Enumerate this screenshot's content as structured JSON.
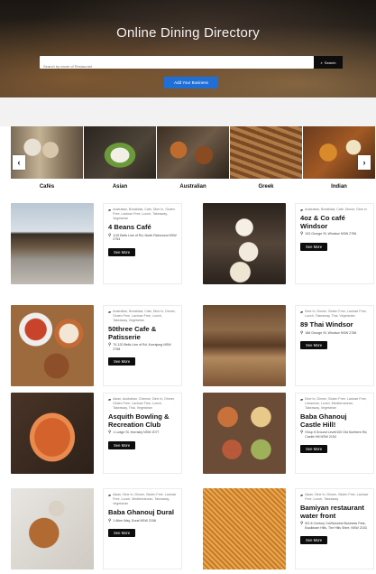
{
  "hero": {
    "title": "Online Dining Directory",
    "search_placeholder": "Search by name of Restaurant",
    "search_button": "Search",
    "add_business_button": "Add Your Business"
  },
  "categories": {
    "prev_arrow": "‹",
    "next_arrow": "›",
    "items": [
      {
        "label": "Cafés"
      },
      {
        "label": "Asian"
      },
      {
        "label": "Australian"
      },
      {
        "label": "Greek"
      },
      {
        "label": "Indian"
      }
    ]
  },
  "listings": [
    {
      "tags": "Australian, Breakfast, Cafe, Dine In, Gluten Free, Lactose Free, Lunch, Takeaway, Vegetarian",
      "name": "4 Beans Café",
      "address": "1/15 Bells Line of Rd, North Richmond NSW 2754",
      "button": "See More"
    },
    {
      "tags": "Australian, Breakfast, Cafe, Dinner, Dine In",
      "name": "4oz & Co café Windsor",
      "address": "103 George St, Windsor NSW 2756",
      "button": "See More"
    },
    {
      "tags": "Australian, Breakfast, Cafe, Dine In, Dinner, Gluten Free, Lactose Free, Lunch, Takeaway, Vegetarian",
      "name": "50three Cafe & Patisserie",
      "address": "70-120 Bells Line of Rd, Kurrajong NSW 2758",
      "button": "See More"
    },
    {
      "tags": "Dine In, Dinner, Gluten Free, Lactose Free, Lunch, Takeaway, Thai, Vegetarian",
      "name": "89 Thai Windsor",
      "address": "186 George St, Windsor NSW 2756",
      "button": "See More"
    },
    {
      "tags": "Asian, Australian, Chinese, Dine In, Dinner, Gluten Free, Lactose Free, Lunch, Takeaway, Thai, Vegetarian",
      "name": "Asquith Bowling & Recreation Club",
      "address": "1 Lodge St, Hornsby NSW 2077",
      "button": "See More"
    },
    {
      "tags": "Dine In, Dinner, Gluten Free, Lactose Free, Lebanese, Lunch, Mediterranean, Takeaway, Vegetarian",
      "name": "Baba Ghanouj Castle Hill!",
      "address": "Shop 5 Ground Level/100 Old Northern Rd, Castle Hill NSW 2154",
      "button": "See More"
    },
    {
      "tags": "Asian, Dine In, Dinner, Gluten Free, Lactose Free, Lunch, Mediterranean, Takeaway, Vegetarian",
      "name": "Baba Ghanouj Dural",
      "address": "1 Allen Way, Dural NSW 2158",
      "button": "See More"
    },
    {
      "tags": "Asian, Dine In, Dinner, Gluten Free, Lactose Free, Lunch, Takeaway",
      "name": "Bamiyan restaurant water front",
      "address": "5/2-8 Century Cct/Norwest Business Park, Baulkham Hills, The Hills Shire, NSW 2153",
      "button": "See More"
    }
  ]
}
